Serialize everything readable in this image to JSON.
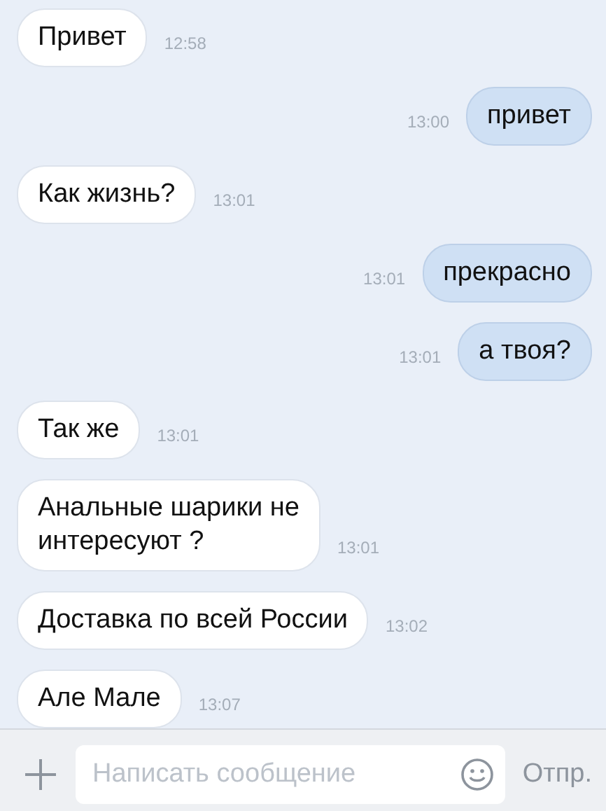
{
  "messages": [
    {
      "kind": "in",
      "text": "Привет",
      "time": "12:58"
    },
    {
      "kind": "out",
      "text": "привет",
      "time": "13:00"
    },
    {
      "kind": "in",
      "text": "Как жизнь?",
      "time": "13:01"
    },
    {
      "kind": "out",
      "text": "прекрасно",
      "time": "13:01"
    },
    {
      "kind": "out",
      "text": "а твоя?",
      "time": "13:01"
    },
    {
      "kind": "in",
      "text": "Так же",
      "time": "13:01"
    },
    {
      "kind": "in",
      "text": "Анальные шарики не\nинтересуют ?",
      "time": "13:01"
    },
    {
      "kind": "in",
      "text": "Доставка по всей России",
      "time": "13:02"
    },
    {
      "kind": "in",
      "text": "Але Мале",
      "time": "13:07"
    }
  ],
  "composer": {
    "placeholder": "Написать сообщение",
    "send": "Отпр."
  }
}
